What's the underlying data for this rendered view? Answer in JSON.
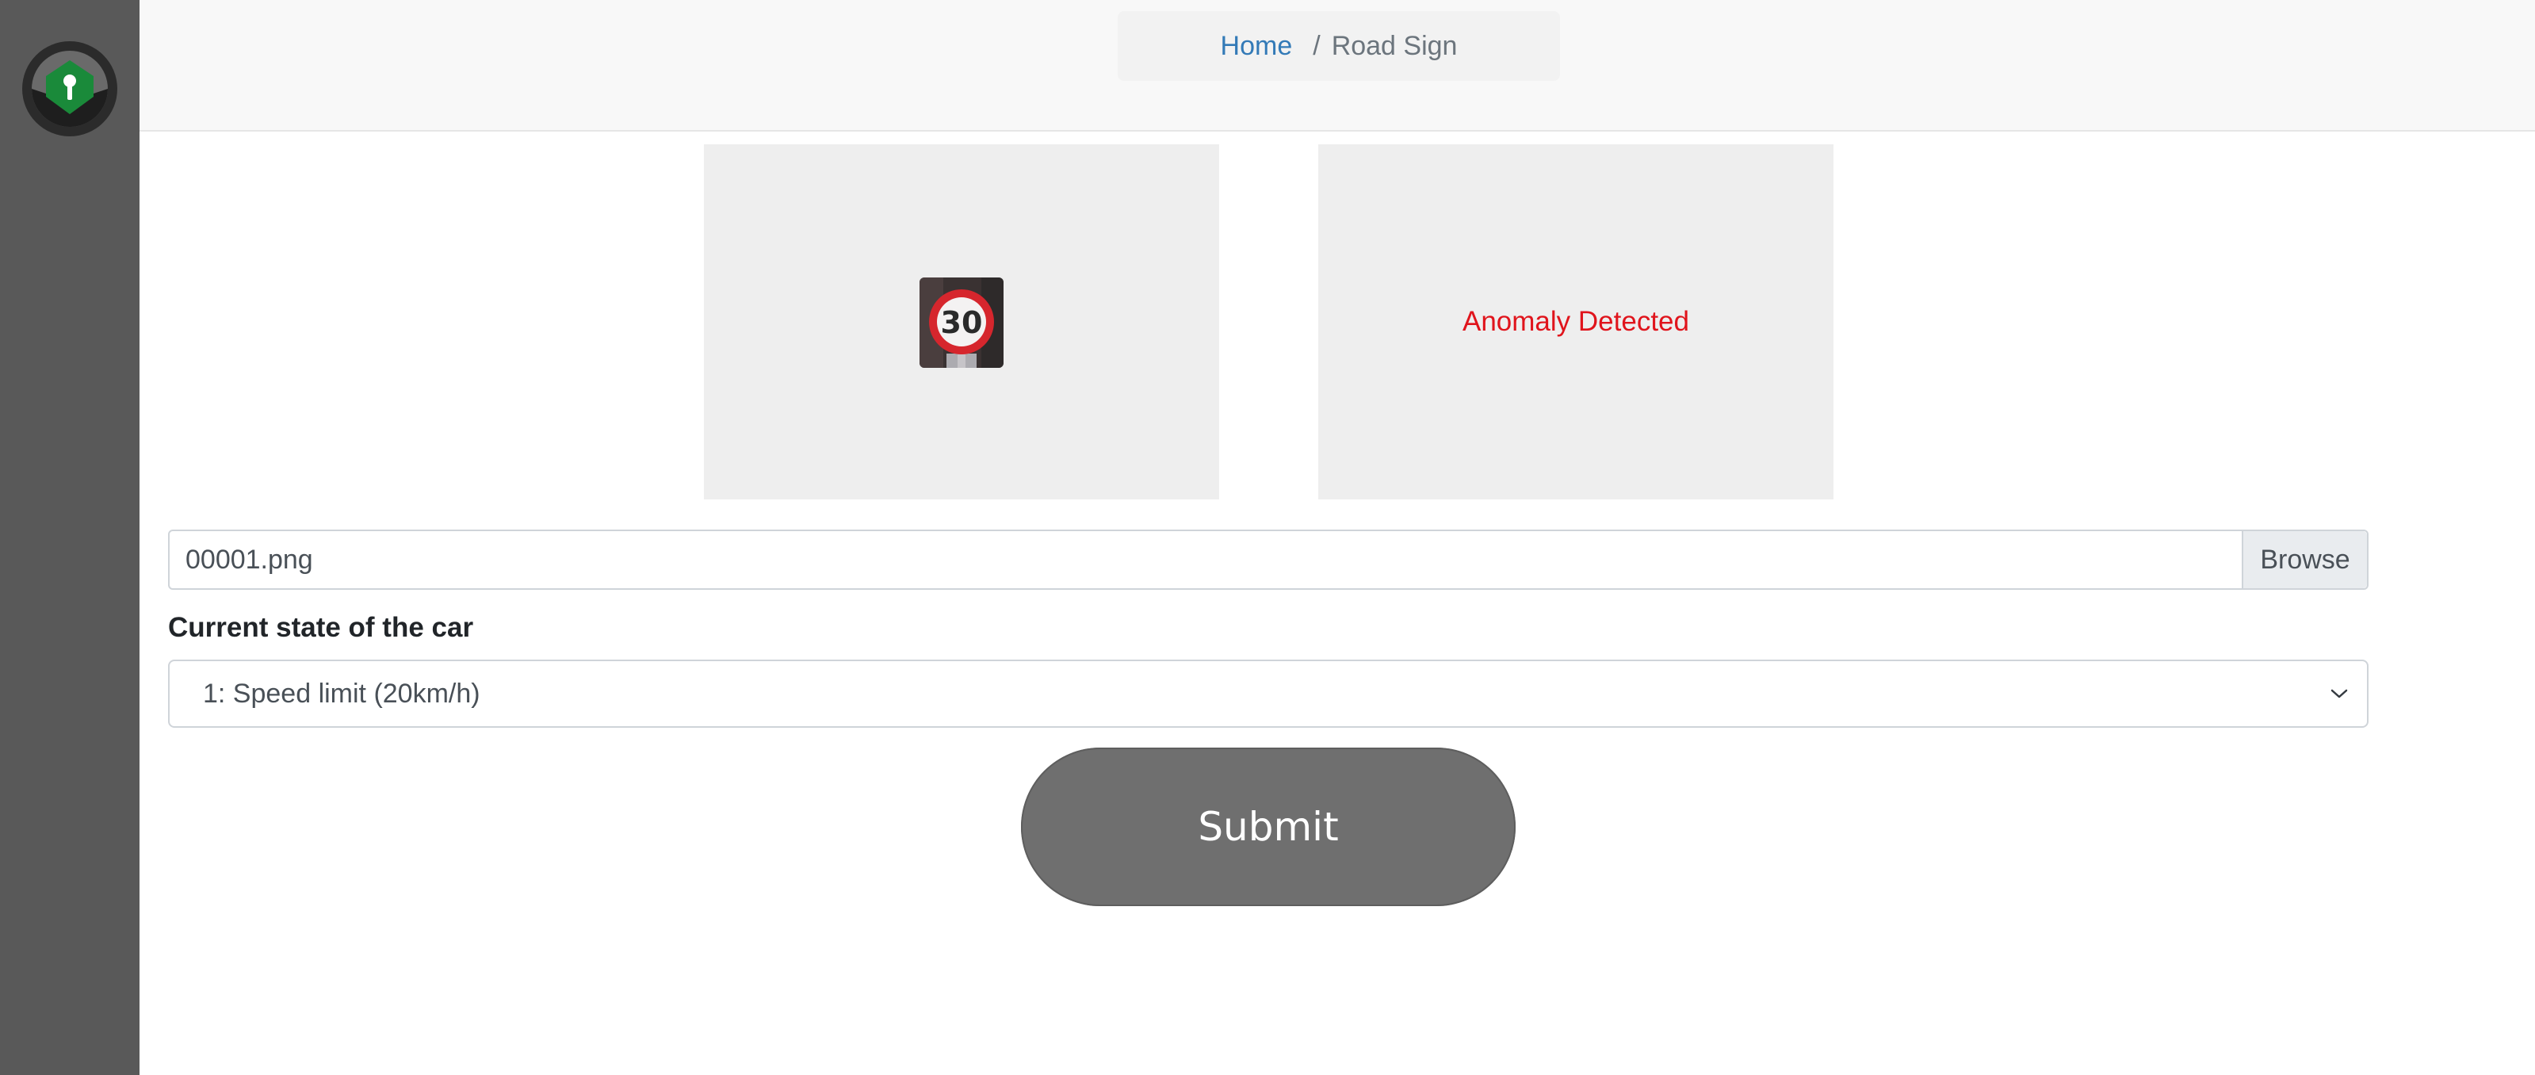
{
  "breadcrumb": {
    "home": "Home",
    "separator": "/",
    "current": "Road Sign"
  },
  "preview": {
    "sign_text": "30"
  },
  "result": {
    "text": "Anomaly Detected",
    "color": "#e0141c"
  },
  "file_input": {
    "value": "00001.png",
    "browse_label": "Browse"
  },
  "car_state": {
    "label": "Current state of the car",
    "selected": "1: Speed limit (20km/h)"
  },
  "submit_label": "Submit",
  "icons": {
    "logo": "steering-wheel-lock-icon",
    "chevron": "chevron-down-icon"
  },
  "colors": {
    "sidebar": "#595959",
    "logo_green": "#1a8a3a",
    "link": "#337ab7",
    "submit_bg": "#6f6f6f"
  }
}
